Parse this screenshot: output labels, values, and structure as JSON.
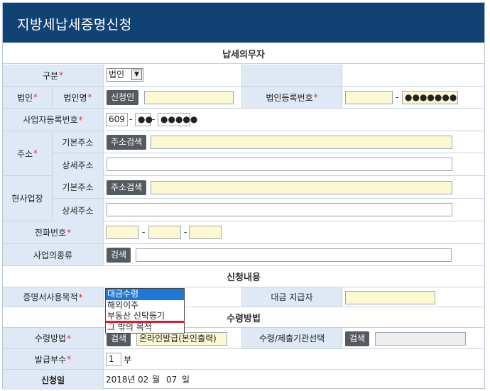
{
  "title": "지방세납세증명신청",
  "sections": {
    "taxpayer": "납세의무자",
    "request": "신청내용",
    "receive": "수령방법"
  },
  "fields": {
    "category_label": "구분",
    "category_value": "법인",
    "corp_label": "법인",
    "corp_name_label": "법인명",
    "applicant_button": "신청인",
    "corp_reg_label": "법인등록번호",
    "corp_reg_masked": "●●●●●●●",
    "biz_reg_label": "사업자등록번호",
    "biz_reg_part1": "609",
    "biz_reg_part2": "●●",
    "biz_reg_part3": "●●●●●",
    "address_label": "주소",
    "basic_address_label": "기본주소",
    "address_search_button": "주소검색",
    "detail_address_label": "상세주소",
    "current_site_label": "현사업장",
    "phone_label": "전화번호",
    "business_type_label": "사업의종류",
    "search_button": "검색",
    "purpose_label": "증명서사용목적",
    "payment_payer_label": "대금 지급자",
    "receive_method_label": "수령방법",
    "receive_method_button": "검색",
    "receive_method_value": "온라인발급(본인출력)",
    "receive_agency_label": "수령/제출기관선택",
    "copies_label": "발급부수",
    "copies_value": "1",
    "copies_unit": "부",
    "apply_date_label": "신청일",
    "apply_date_year": "2018년",
    "apply_date_month": "02",
    "apply_date_month_unit": "월",
    "apply_date_day": "07",
    "apply_date_day_unit": "일",
    "dash": "-"
  },
  "purpose_dropdown": {
    "options": [
      "대금수령",
      "해외이주",
      "부동산 신탁등기",
      "그 밖의 목적"
    ],
    "highlighted_index": 0
  },
  "colors": {
    "header_bg": "#104273",
    "label_bg": "#dfe9f5",
    "required": "#d9332b",
    "button_bg": "#555a60",
    "input_highlight": "#fcf8d2",
    "dropdown_highlight": "#1e78d7",
    "annotation_red": "#d0213a"
  }
}
